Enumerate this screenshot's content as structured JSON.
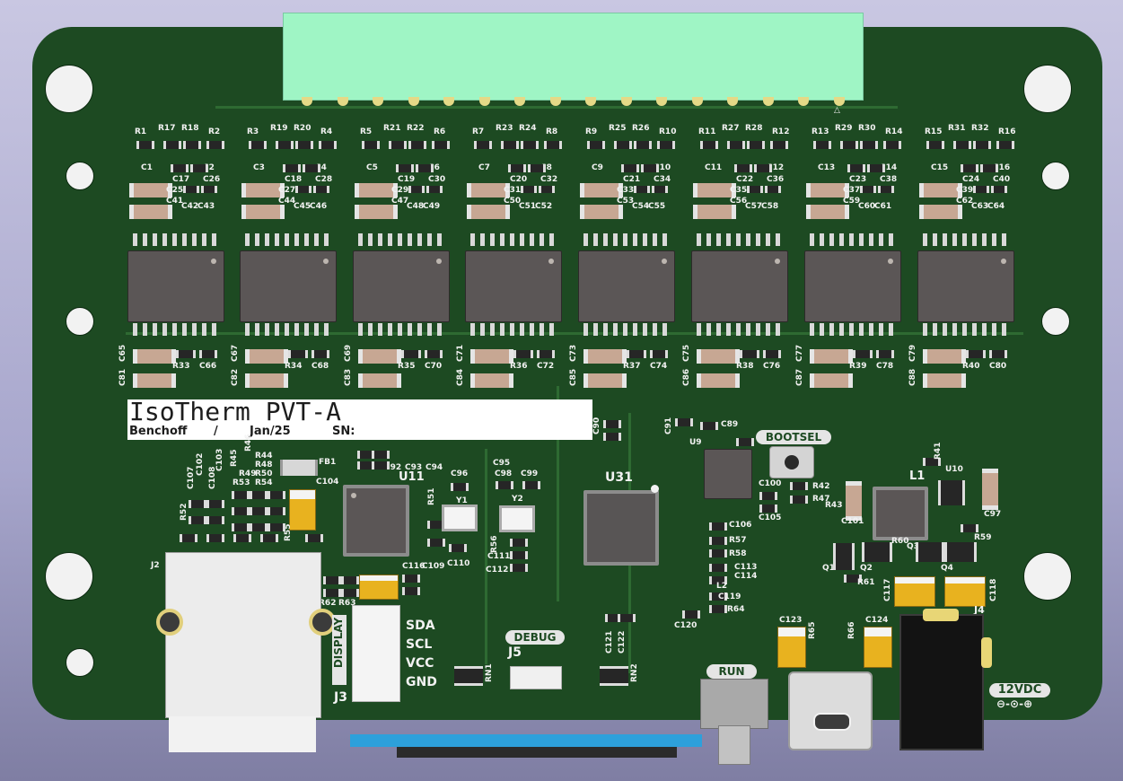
{
  "board": {
    "title": "IsoTherm PVT-A",
    "author": "Benchoff",
    "separator": "/",
    "date": "Jan/25",
    "sn_label": "SN:",
    "colors": {
      "pcb": "#1d4a22",
      "silk": "#f2f2f2",
      "connector": "#9ff5c5",
      "tantalum": "#e8b21f"
    }
  },
  "channels": [
    {
      "r": [
        "R1",
        "R17",
        "R18",
        "R2"
      ],
      "c_top": [
        "C1",
        "C17",
        "C2",
        "C26"
      ],
      "c_mid": [
        "C25",
        "C41",
        "C42",
        "C43"
      ],
      "bottom": [
        "C65",
        "C81",
        "R33",
        "C66"
      ]
    },
    {
      "r": [
        "R3",
        "R19",
        "R20",
        "R4"
      ],
      "c_top": [
        "C3",
        "C18",
        "C4",
        "C28"
      ],
      "c_mid": [
        "C27",
        "C44",
        "C45",
        "C46"
      ],
      "bottom": [
        "C67",
        "C82",
        "R34",
        "C68"
      ]
    },
    {
      "r": [
        "R5",
        "R21",
        "R22",
        "R6"
      ],
      "c_top": [
        "C5",
        "C19",
        "C6",
        "C30"
      ],
      "c_mid": [
        "C29",
        "C47",
        "C48",
        "C49"
      ],
      "bottom": [
        "C69",
        "C83",
        "R35",
        "C70"
      ]
    },
    {
      "r": [
        "R7",
        "R23",
        "R24",
        "R8"
      ],
      "c_top": [
        "C7",
        "C20",
        "C8",
        "C32"
      ],
      "c_mid": [
        "C31",
        "C50",
        "C51",
        "C52"
      ],
      "bottom": [
        "C71",
        "C84",
        "R36",
        "C72"
      ]
    },
    {
      "r": [
        "R9",
        "R25",
        "R26",
        "R10"
      ],
      "c_top": [
        "C9",
        "C21",
        "C10",
        "C34"
      ],
      "c_mid": [
        "C33",
        "C53",
        "C54",
        "C55"
      ],
      "bottom": [
        "C73",
        "C85",
        "R37",
        "C74"
      ]
    },
    {
      "r": [
        "R11",
        "R27",
        "R28",
        "R12"
      ],
      "c_top": [
        "C11",
        "C22",
        "C12",
        "C36"
      ],
      "c_mid": [
        "C35",
        "C56",
        "C57",
        "C58"
      ],
      "bottom": [
        "C75",
        "C86",
        "R38",
        "C76"
      ]
    },
    {
      "r": [
        "R13",
        "R29",
        "R30",
        "R14"
      ],
      "c_top": [
        "C13",
        "C23",
        "C14",
        "C38"
      ],
      "c_mid": [
        "C37",
        "C59",
        "C60",
        "C61"
      ],
      "bottom": [
        "C77",
        "C87",
        "R39",
        "C78"
      ]
    },
    {
      "r": [
        "R15",
        "R31",
        "R32",
        "R16"
      ],
      "c_top": [
        "C15",
        "C24",
        "C16",
        "C40"
      ],
      "c_mid": [
        "C39",
        "C62",
        "C63",
        "C64"
      ],
      "bottom": [
        "C79",
        "C88",
        "R40",
        "C80"
      ]
    }
  ],
  "left_refs": {
    "fb1": "FB1",
    "u11": "U11",
    "c92": "C92",
    "c93": "C93",
    "c94": "C94",
    "c104": "C104",
    "c107": "C107",
    "c102": "C102",
    "c103": "C103",
    "c108": "C108",
    "r45": "R45",
    "r44": "R44",
    "r48": "R48",
    "r46": "R46",
    "r49": "R49",
    "r50": "R50",
    "r53": "R53",
    "r54": "R54",
    "r52": "R52",
    "r55": "R55",
    "r51": "R51",
    "c116": "C116",
    "c109": "C109",
    "c110": "C110",
    "c96": "C96",
    "y1": "Y1",
    "r62": "R62",
    "r63": "R63",
    "j2": "J2"
  },
  "display_conn": {
    "label": "DISPLAY",
    "ref": "J3",
    "pins": [
      "SDA",
      "SCL",
      "VCC",
      "GND"
    ]
  },
  "center_refs": {
    "c90": "C90",
    "c95": "C95",
    "c98": "C98",
    "c99": "C99",
    "y2": "Y2",
    "r56": "R56",
    "c111": "C111",
    "c112": "C112",
    "u31": "U31",
    "c91": "C91",
    "c89": "C89",
    "u9": "U9",
    "debug": "DEBUG",
    "j5": "J5",
    "rn1": "RN1",
    "rn2": "RN2",
    "c121": "C121",
    "c122": "C122"
  },
  "right_refs": {
    "bootsel": "BOOTSEL",
    "c100": "C100",
    "c105": "C105",
    "r42": "R42",
    "r47": "R47",
    "r43": "R43",
    "c101": "C101",
    "l1": "L1",
    "r41": "R41",
    "u10": "U10",
    "c97": "C97",
    "c106": "C106",
    "r57": "R57",
    "r58": "R58",
    "c113": "C113",
    "c114": "C114",
    "l2": "L2",
    "c119": "C119",
    "r64": "R64",
    "c120": "C120",
    "r60": "R60",
    "q3": "Q3",
    "r59": "R59",
    "q1": "Q1",
    "q2": "Q2",
    "q4": "Q4",
    "r61": "R61",
    "c117": "C117",
    "c118": "C118",
    "j4": "J4",
    "c123": "C123",
    "r65": "R65",
    "r66": "R66",
    "c124": "C124",
    "run": "RUN",
    "power": "12VDC",
    "polarity": "⊖-⊙-⊕"
  }
}
